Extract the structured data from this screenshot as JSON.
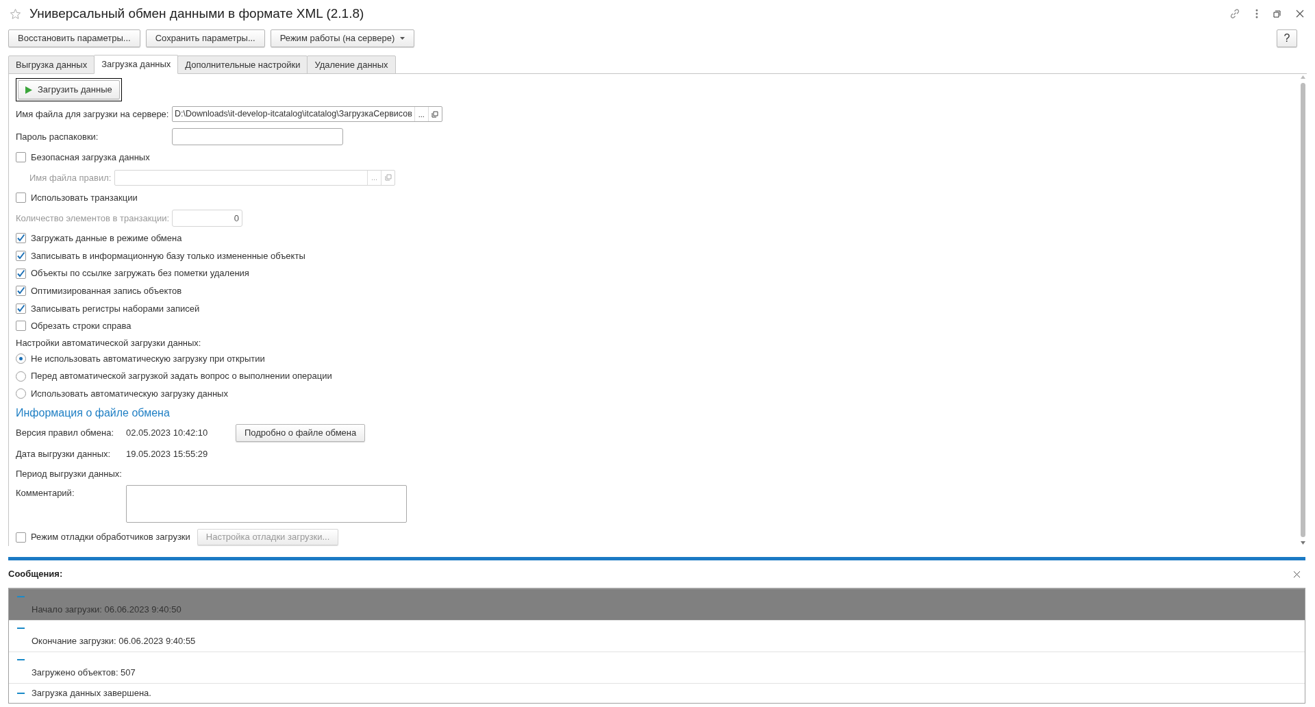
{
  "window": {
    "title": "Универсальный обмен данными в формате XML (2.1.8)"
  },
  "toolbar": [
    {
      "label": "Восстановить параметры...",
      "dropdown": false
    },
    {
      "label": "Сохранить параметры...",
      "dropdown": false
    },
    {
      "label": "Режим работы (на сервере)",
      "dropdown": true
    }
  ],
  "help_button": "?",
  "tabs": [
    {
      "label": "Выгрузка данных",
      "selected": false
    },
    {
      "label": "Загрузка данных",
      "selected": true
    },
    {
      "label": "Дополнительные настройки",
      "selected": false
    },
    {
      "label": "Удаление данных",
      "selected": false
    }
  ],
  "load_button": "Загрузить данные",
  "server_file": {
    "label": "Имя файла для загрузки на сервере:",
    "value": "D:\\Downloads\\it-develop-itcatalog\\itcatalog\\ЗагрузкаСервисов",
    "choose_button": "..."
  },
  "unpack_password": {
    "label": "Пароль распаковки:"
  },
  "safe_load": {
    "label": "Безопасная загрузка данных",
    "checked": false
  },
  "rules_file": {
    "label": "Имя файла правил:",
    "choose_button": "...",
    "disabled": true
  },
  "use_transactions": {
    "label": "Использовать транзакции",
    "checked": false
  },
  "transaction_count": {
    "label": "Количество элементов в транзакции:",
    "value": "0",
    "disabled": true
  },
  "options": [
    {
      "label": "Загружать данные в режиме обмена",
      "checked": true
    },
    {
      "label": "Записывать в информационную базу только измененные объекты",
      "checked": true
    },
    {
      "label": "Объекты по ссылке загружать без пометки удаления",
      "checked": true
    },
    {
      "label": "Оптимизированная запись объектов",
      "checked": true
    },
    {
      "label": "Записывать регистры наборами записей",
      "checked": true
    },
    {
      "label": "Обрезать строки справа",
      "checked": false
    }
  ],
  "auto_load": {
    "label": "Настройки автоматической загрузки данных:",
    "options": [
      {
        "label": "Не использовать автоматическую загрузку при открытии",
        "selected": true
      },
      {
        "label": "Перед автоматической загрузкой задать вопрос о выполнении операции",
        "selected": false
      },
      {
        "label": "Использовать автоматическую загрузку данных",
        "selected": false
      }
    ]
  },
  "exchange_file_info": {
    "heading": "Информация о файле обмена",
    "rules_version": {
      "label": "Версия правил обмена:",
      "value": "02.05.2023 10:42:10"
    },
    "details_button": "Подробно о файле обмена",
    "export_date": {
      "label": "Дата выгрузки данных:",
      "value": "19.05.2023 15:55:29"
    },
    "export_period": {
      "label": "Период выгрузки данных:"
    },
    "comment": {
      "label": "Комментарий:"
    }
  },
  "debug": {
    "label": "Режим отладки обработчиков загрузки",
    "checked": false,
    "settings_button": {
      "label": "Настройка отладки загрузки...",
      "disabled": true
    }
  },
  "messages": {
    "title": "Сообщения:",
    "items": [
      {
        "text": "Начало загрузки: 06.06.2023 9:40:50",
        "kind": "wrapped",
        "selected": true
      },
      {
        "text": "Окончание загрузки: 06.06.2023 9:40:55",
        "kind": "wrapped",
        "selected": false
      },
      {
        "text": "Загружено объектов: 507",
        "kind": "wrapped",
        "selected": false
      },
      {
        "text": "Загрузка данных завершена.",
        "kind": "inline",
        "selected": false
      }
    ]
  }
}
